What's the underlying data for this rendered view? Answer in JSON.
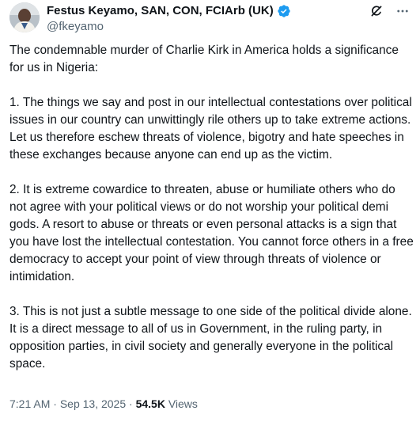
{
  "author": {
    "display_name": "Festus Keyamo, SAN, CON, FCIArb (UK)",
    "handle": "@fkeyamo",
    "verified": true,
    "verified_color": "#1d9bf0"
  },
  "icons": {
    "avatar": "profile-photo",
    "verified": "verified-badge-icon",
    "grok": "grok-icon",
    "more": "more-options-icon"
  },
  "tweet": {
    "paragraphs": [
      "The condemnable murder of Charlie Kirk in America holds a significance for us in Nigeria:",
      "1. The things we say and post in our intellectual contestations over political issues in our country can unwittingly rile others up to take extreme actions. Let us therefore eschew threats of violence, bigotry and hate speeches in these exchanges because anyone can end up as the victim.",
      "2. It is extreme cowardice to threaten, abuse or humiliate others who do not agree with your political views or do not worship your political demi gods. A resort to abuse or threats or even personal attacks is a sign that you have lost the intellectual contestation. You cannot force others in a free democracy to accept your point of view through threats of violence or intimidation.",
      "3. This is not just a subtle message to one side of the political divide alone. It is a direct message to all of us in Government, in the ruling party, in opposition parties, in civil society and generally everyone in the political space."
    ]
  },
  "meta": {
    "time": "7:21 AM",
    "separator": "·",
    "date": "Sep 13, 2025",
    "views_count": "54.5K",
    "views_label": "Views"
  }
}
